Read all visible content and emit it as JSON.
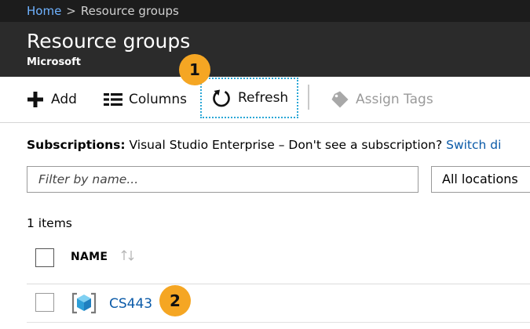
{
  "breadcrumb": {
    "home": "Home",
    "separator": ">",
    "current": "Resource groups"
  },
  "header": {
    "title": "Resource groups",
    "subtitle": "Microsoft"
  },
  "toolbar": {
    "add_label": "Add",
    "columns_label": "Columns",
    "refresh_label": "Refresh",
    "assign_tags_label": "Assign Tags",
    "assign_tags_enabled": false
  },
  "callouts": {
    "first": "1",
    "second": "2",
    "color": "#f5a623"
  },
  "subscriptions": {
    "label": "Subscriptions:",
    "value": "Visual Studio Enterprise",
    "separator": "–",
    "prompt": "Don't see a subscription?",
    "link": "Switch di"
  },
  "filter": {
    "placeholder": "Filter by name...",
    "value": ""
  },
  "locations": {
    "selected": "All locations"
  },
  "list": {
    "count_text": "1 items",
    "column_name": "NAME",
    "rows": [
      {
        "name": "CS443",
        "icon": "resource-group-icon"
      }
    ]
  },
  "colors": {
    "accent_link": "#0a5aa8",
    "breadcrumb_link": "#6fb2ff",
    "header_bg": "#2b2b2b",
    "breadcrumb_bg": "#1c1c1c",
    "focus_border": "#2aa7d6"
  }
}
